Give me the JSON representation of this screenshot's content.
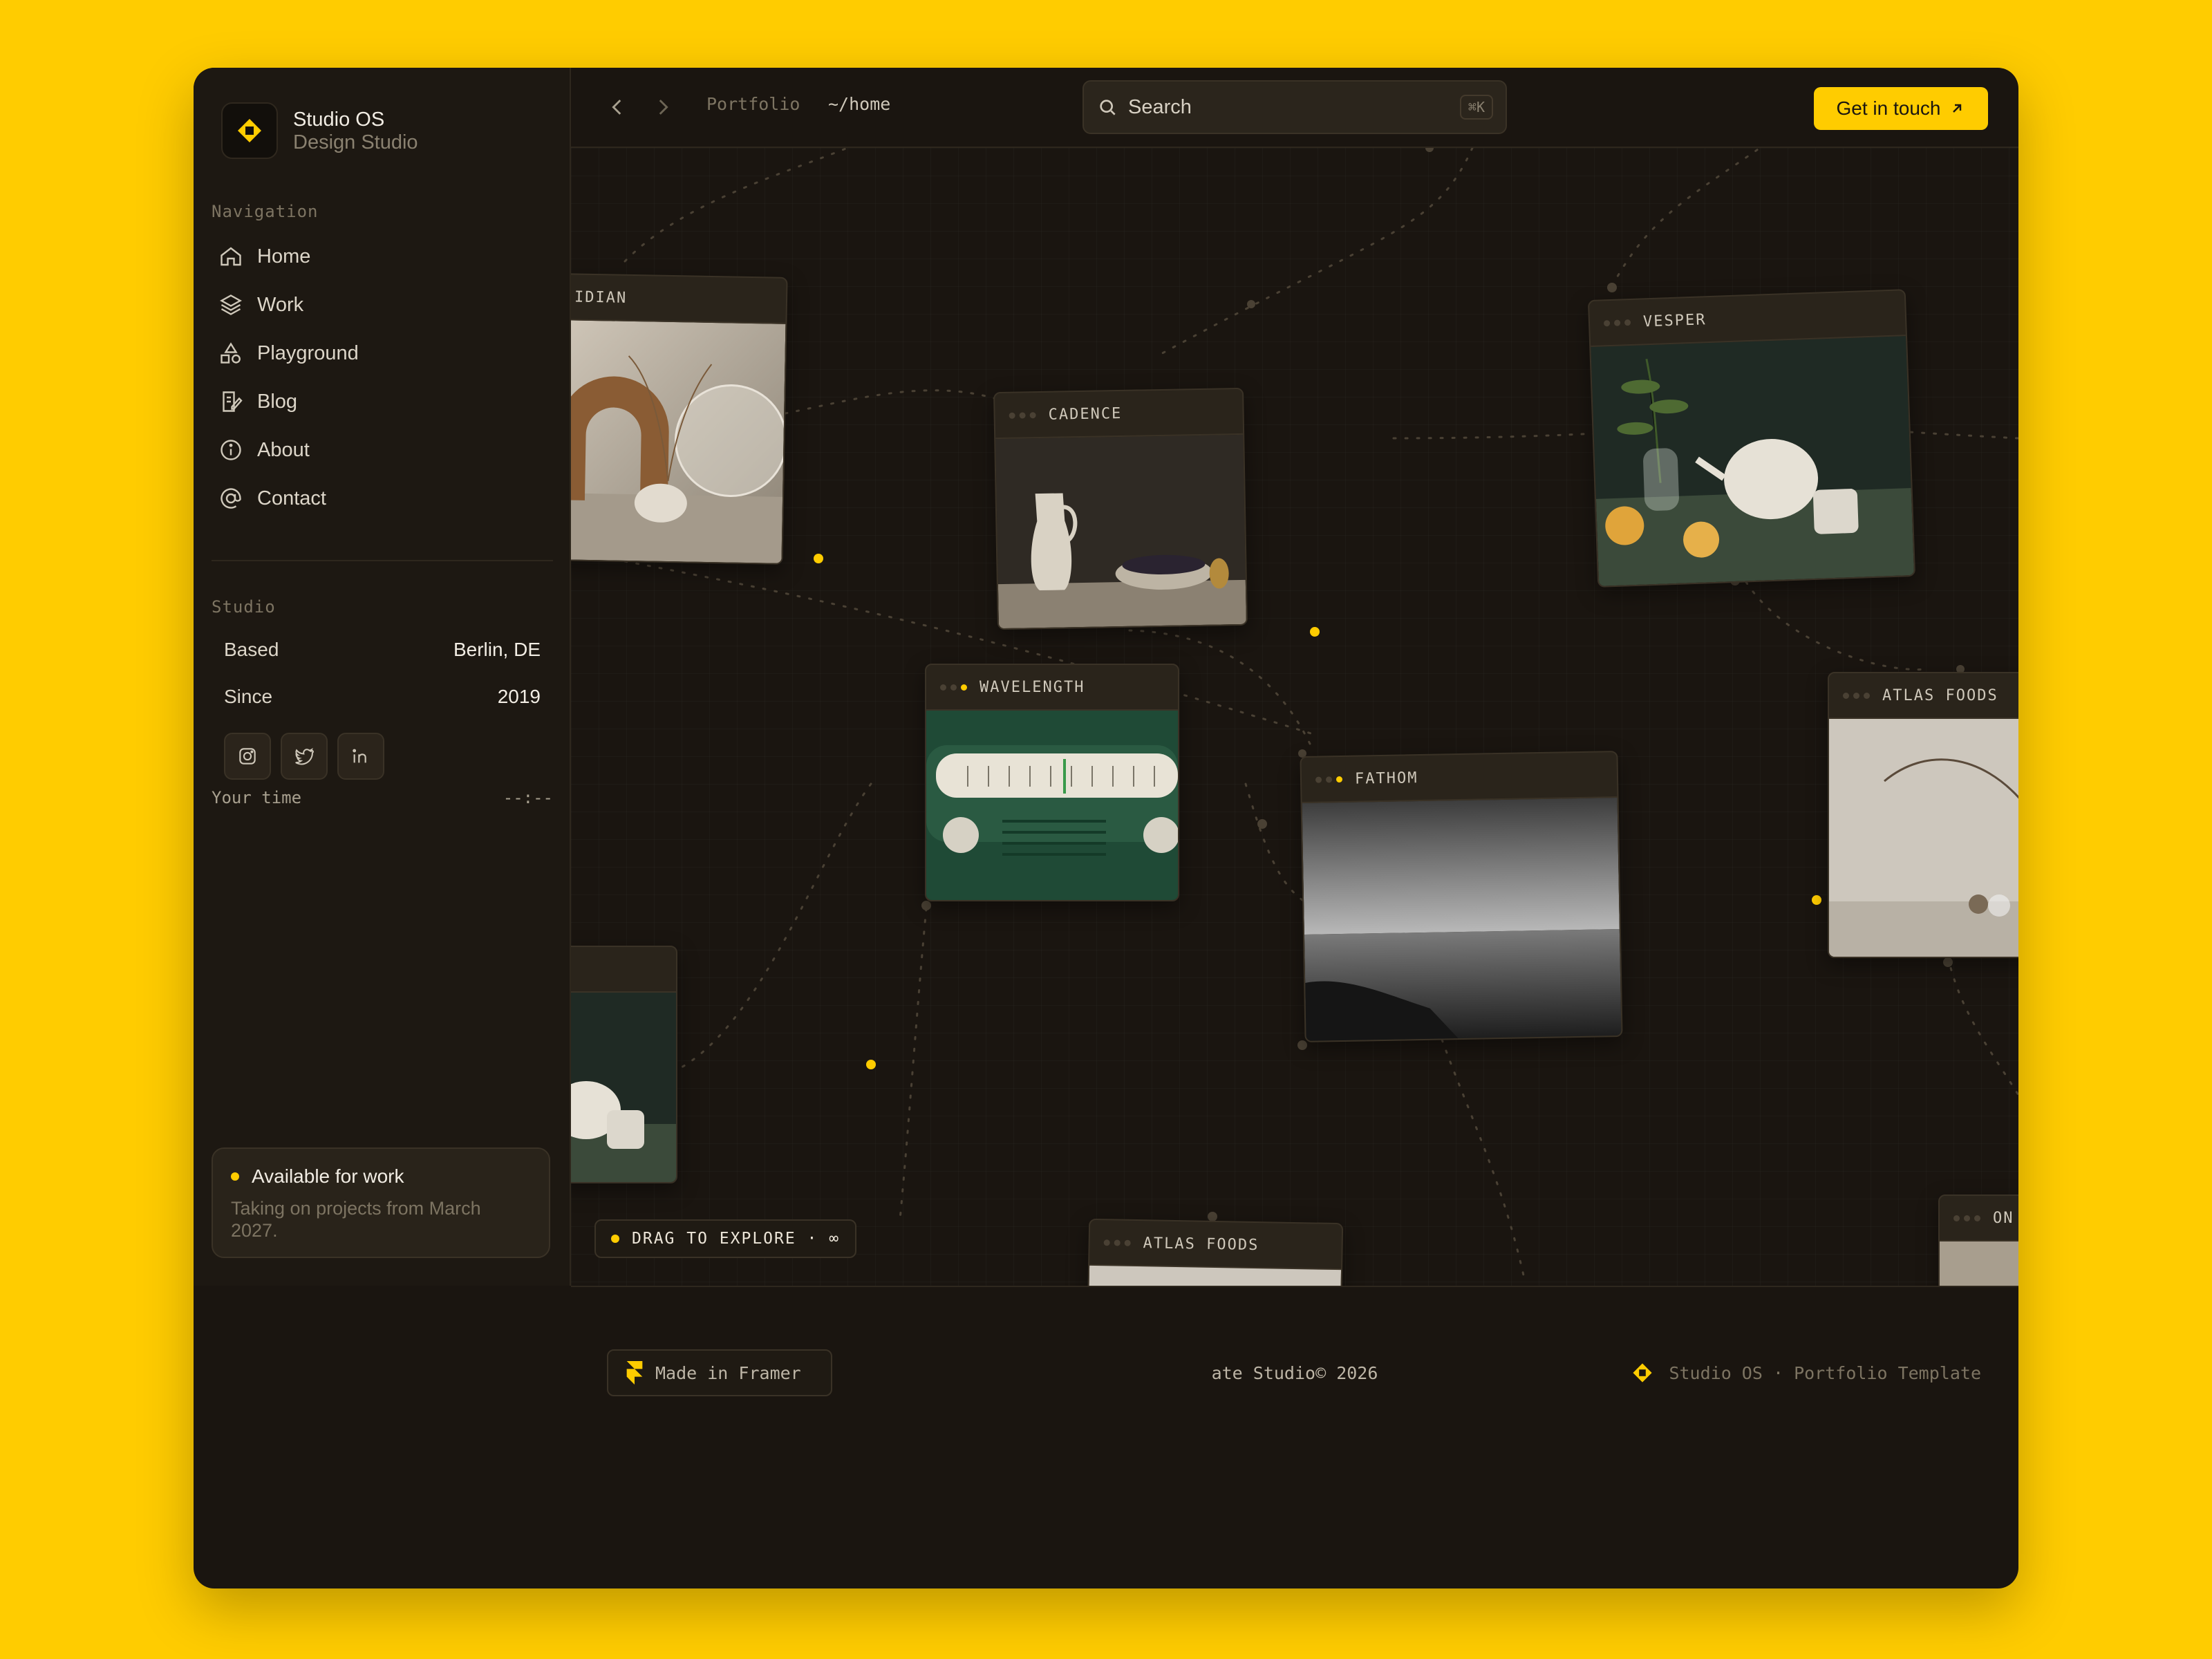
{
  "brand": {
    "name": "Studio OS",
    "subtitle": "Design Studio"
  },
  "sidebar": {
    "nav_label": "Navigation",
    "items": [
      {
        "label": "Home",
        "icon": "home-icon"
      },
      {
        "label": "Work",
        "icon": "layers-icon"
      },
      {
        "label": "Playground",
        "icon": "shapes-icon"
      },
      {
        "label": "Blog",
        "icon": "edit-note-icon"
      },
      {
        "label": "About",
        "icon": "info-icon"
      },
      {
        "label": "Contact",
        "icon": "at-icon"
      }
    ],
    "studio_label": "Studio",
    "based_label": "Based",
    "based_value": "Berlin, DE",
    "since_label": "Since",
    "since_value": "2019",
    "socials": [
      "instagram-icon",
      "twitter-icon",
      "linkedin-icon"
    ],
    "time_label": "Your time",
    "time_value": "--:--",
    "availability": {
      "title": "Available for work",
      "desc": "Taking on projects from March 2027."
    }
  },
  "topbar": {
    "crumb_1": "Portfolio",
    "crumb_2": "~/home",
    "search_placeholder": "Search",
    "search_shortcut": "⌘K",
    "cta_label": "Get in touch"
  },
  "canvas": {
    "cards": [
      {
        "title": "IDIAN"
      },
      {
        "title": "CADENCE"
      },
      {
        "title": "VESPER"
      },
      {
        "title": "WAVELENGTH"
      },
      {
        "title": "FATHOM"
      },
      {
        "title": "ATLAS FOODS"
      },
      {
        "title": "ATLAS FOODS"
      },
      {
        "title": "ON"
      }
    ],
    "drag_hint": "DRAG TO EXPLORE · ∞"
  },
  "footer": {
    "made_in": "Made in Framer",
    "copyright": "ate Studio© 2026",
    "template": "Studio OS · Portfolio Template"
  },
  "colors": {
    "accent": "#FFCC00",
    "window_bg": "#1a1510",
    "sidebar_bg": "#1d1812",
    "card_bg": "#2a241b"
  }
}
